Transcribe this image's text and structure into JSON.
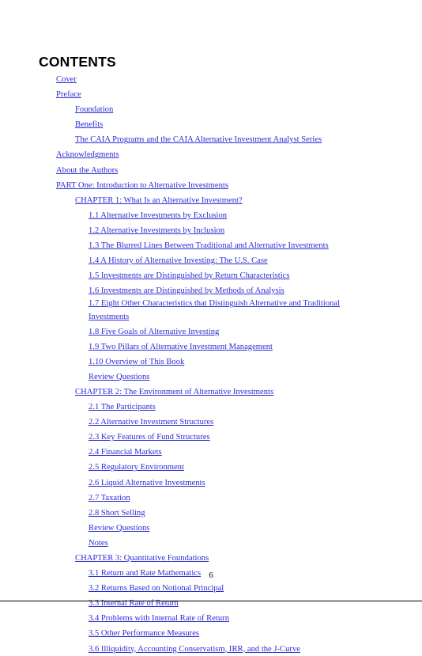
{
  "document": {
    "heading": "CONTENTS",
    "page_number": "6",
    "link_color": "#2b2bd4",
    "text_color": "#000000",
    "background_color": "#ffffff"
  },
  "toc": {
    "entries": [
      {
        "label": "Cover",
        "level": 1
      },
      {
        "label": "Preface",
        "level": 1
      },
      {
        "label": "Foundation",
        "level": 2
      },
      {
        "label": "Benefits",
        "level": 2
      },
      {
        "label": "The CAIA Programs and the CAIA Alternative Investment Analyst Series",
        "level": 2
      },
      {
        "label": "Acknowledgments",
        "level": 1
      },
      {
        "label": "About the Authors",
        "level": 1
      },
      {
        "label": "PART One: Introduction to Alternative Investments",
        "level": 1
      },
      {
        "label": "CHAPTER 1: What Is an Alternative Investment?",
        "level": 2
      },
      {
        "label": "1.1 Alternative Investments by Exclusion",
        "level": 3
      },
      {
        "label": "1.2 Alternative Investments by Inclusion",
        "level": 3
      },
      {
        "label": "1.3 The Blurred Lines Between Traditional and Alternative Investments",
        "level": 3
      },
      {
        "label": "1.4 A History of Alternative Investing: The U.S. Case",
        "level": 3
      },
      {
        "label": "1.5 Investments are Distinguished by Return Characteristics",
        "level": 3
      },
      {
        "label": "1.6 Investments are Distinguished by Methods of Analysis",
        "level": 3
      },
      {
        "label": "1.7 Eight Other Characteristics that Distinguish Alternative and Traditional Investments",
        "level": 3
      },
      {
        "label": "1.8 Five Goals of Alternative Investing",
        "level": 3
      },
      {
        "label": "1.9 Two Pillars of Alternative Investment Management",
        "level": 3
      },
      {
        "label": "1.10 Overview of This Book",
        "level": 3
      },
      {
        "label": "Review Questions",
        "level": 3
      },
      {
        "label": "CHAPTER 2: The Environment of Alternative Investments",
        "level": 2
      },
      {
        "label": "2.1 The Participants",
        "level": 3
      },
      {
        "label": "2.2 Alternative Investment Structures",
        "level": 3
      },
      {
        "label": "2.3 Key Features of Fund Structures",
        "level": 3
      },
      {
        "label": "2.4 Financial Markets",
        "level": 3
      },
      {
        "label": "2.5 Regulatory Environment",
        "level": 3
      },
      {
        "label": "2.6 Liquid Alternative Investments",
        "level": 3
      },
      {
        "label": "2.7 Taxation",
        "level": 3
      },
      {
        "label": "2.8 Short Selling",
        "level": 3
      },
      {
        "label": "Review Questions",
        "level": 3
      },
      {
        "label": "Notes",
        "level": 3
      },
      {
        "label": "CHAPTER 3: Quantitative Foundations",
        "level": 2
      },
      {
        "label": "3.1 Return and Rate Mathematics",
        "level": 3
      },
      {
        "label": "3.2 Returns Based on Notional Principal",
        "level": 3
      },
      {
        "label": "3.3 Internal Rate of Return",
        "level": 3
      },
      {
        "label": "3.4 Problems with Internal Rate of Return",
        "level": 3
      },
      {
        "label": "3.5 Other Performance Measures",
        "level": 3
      },
      {
        "label": "3.6 Illiquidity, Accounting Conservatism, IRR, and the J-Curve",
        "level": 3
      }
    ]
  }
}
